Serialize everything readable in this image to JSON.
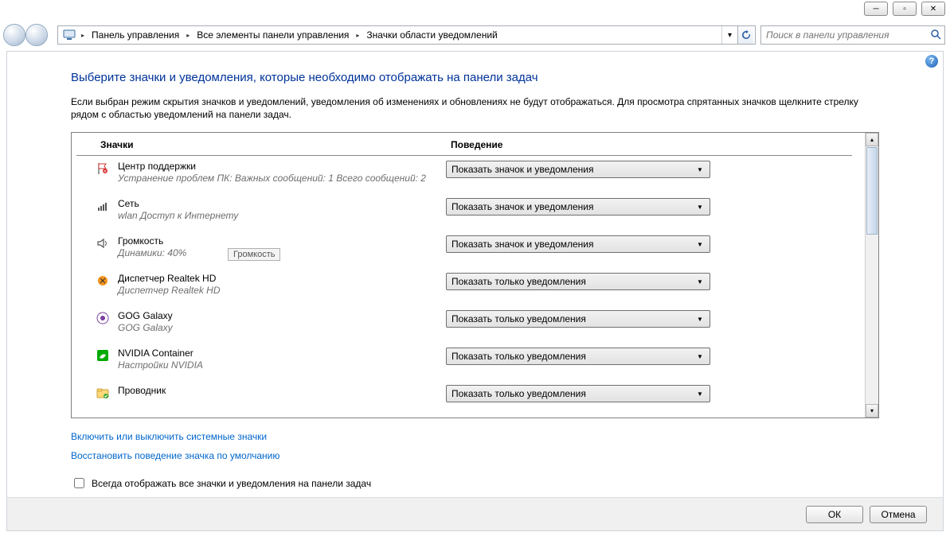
{
  "window": {
    "btn_min": "—",
    "btn_max": "▢",
    "btn_close": "✕"
  },
  "breadcrumb": {
    "item1": "Панель управления",
    "item2": "Все элементы панели управления",
    "item3": "Значки области уведомлений"
  },
  "search": {
    "placeholder": "Поиск в панели управления"
  },
  "page": {
    "title": "Выберите значки и уведомления, которые необходимо отображать на панели задач",
    "description": "Если выбран режим скрытия значков и уведомлений, уведомления об изменениях и обновлениях не будут отображаться. Для просмотра спрятанных значков щелкните стрелку рядом с областью уведомлений на панели задач."
  },
  "columns": {
    "icons": "Значки",
    "behavior": "Поведение"
  },
  "options": {
    "show_icon_and_notif": "Показать значок и уведомления",
    "show_only_notif": "Показать только уведомления"
  },
  "tooltip": "Громкость",
  "rows": [
    {
      "icon": "flag-icon",
      "title": "Центр поддержки",
      "sub": "Устранение проблем ПК: Важных сообщений: 1  Всего сообщений: 2",
      "value_key": "show_icon_and_notif"
    },
    {
      "icon": "network-icon",
      "title": "Сеть",
      "sub": "wlan Доступ к Интернету",
      "value_key": "show_icon_and_notif"
    },
    {
      "icon": "speaker-icon",
      "title": "Громкость",
      "sub": "Динамики: 40%",
      "value_key": "show_icon_and_notif"
    },
    {
      "icon": "realtek-icon",
      "title": "Диспетчер Realtek HD",
      "sub": "Диспетчер Realtek HD",
      "value_key": "show_only_notif"
    },
    {
      "icon": "gog-icon",
      "title": "GOG Galaxy",
      "sub": "GOG Galaxy",
      "value_key": "show_only_notif"
    },
    {
      "icon": "nvidia-icon",
      "title": "NVIDIA Container",
      "sub": "Настройки NVIDIA",
      "value_key": "show_only_notif"
    },
    {
      "icon": "explorer-icon",
      "title": "Проводник",
      "sub": "",
      "value_key": "show_only_notif"
    }
  ],
  "links": {
    "system_icons": "Включить или выключить системные значки",
    "restore_default": "Восстановить поведение значка по умолчанию"
  },
  "checkbox_label": "Всегда отображать все значки и уведомления на панели задач",
  "buttons": {
    "ok": "ОК",
    "cancel": "Отмена"
  }
}
